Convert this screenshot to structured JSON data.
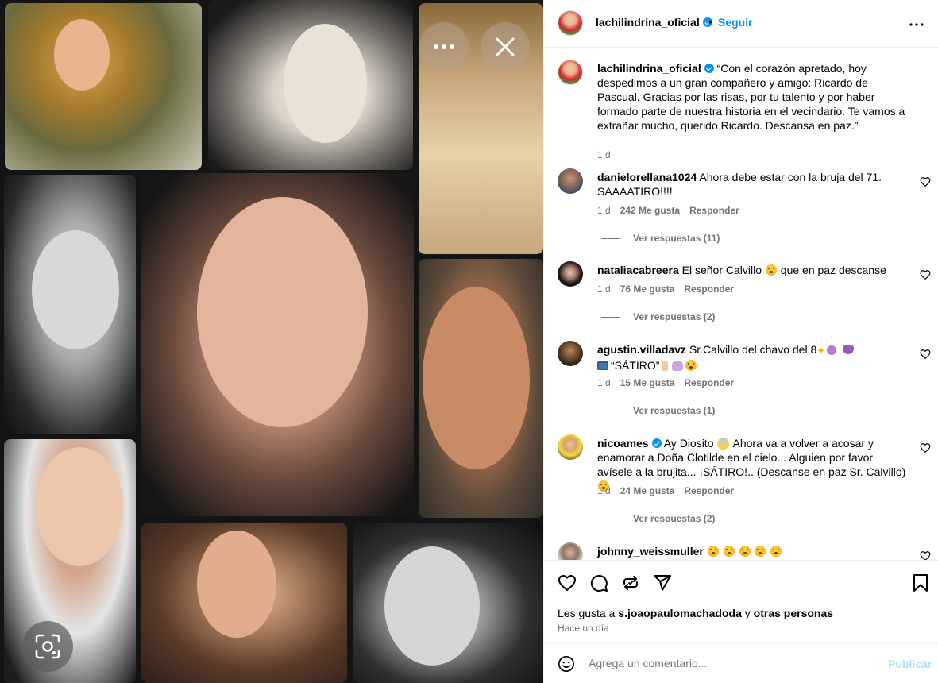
{
  "header": {
    "username": "lachilindrina_oficial",
    "separator": "•",
    "follow_label": "Seguir",
    "more_label": "•••"
  },
  "caption": {
    "username": "lachilindrina_oficial",
    "text": "“Con el corazón apretado, hoy despedimos a un gran compañero y amigo: Ricardo de Pascual. Gracias por las risas, por tu talento y por haber formado parte de nuestra historia en el vecindario. Te vamos a extrañar mucho, querido Ricardo. Descansa en paz.”",
    "time": "1 d"
  },
  "comments": [
    {
      "username": "danielorellana1024",
      "text": "Ahora debe estar con la bruja del 71. SAAAATIRO!!!!",
      "time": "1 d",
      "likes": "242 Me gusta",
      "reply_label": "Responder",
      "view_replies": "Ver respuestas (11)"
    },
    {
      "username": "nataliacabreera",
      "text_before": "El señor Calvillo",
      "text_after": "que en paz descanse",
      "time": "1 d",
      "likes": "76 Me gusta",
      "reply_label": "Responder",
      "view_replies": "Ver respuestas (2)"
    },
    {
      "username": "agustin.villadavz",
      "text_line1": "Sr.Calvillo del chavo del 8",
      "text_line2": "“SÁTIRO”",
      "time": "1 d",
      "likes": "15 Me gusta",
      "reply_label": "Responder",
      "view_replies": "Ver respuestas (1)"
    },
    {
      "username": "nicoames",
      "text_a": "Ay Diosito",
      "text_b": "Ahora va a volver a acosar y enamorar a Doña Clotilde en el cielo... Alguien por favor avísele a la brujita... ¡SÁTIRO!.. (Descanse en paz Sr. Calvillo)",
      "time": "1 d",
      "likes": "24 Me gusta",
      "reply_label": "Responder",
      "view_replies": "Ver respuestas (2)"
    },
    {
      "username": "johnny_weissmuller"
    }
  ],
  "actions": {
    "likes_prefix": "Les gusta a",
    "likes_user": "s.joaopaulomachadoda",
    "likes_mid": "y",
    "likes_others": "otras personas",
    "time": "Hace un día"
  },
  "composer": {
    "placeholder": "Agrega un comentario...",
    "publish_label": "Publicar"
  },
  "colors": {
    "accent": "#0095f6",
    "muted": "#737373",
    "publish_disabled": "#b2dffc"
  },
  "icons": [
    "more-icon",
    "close-icon",
    "lens-icon",
    "heart-icon",
    "comment-icon",
    "share-icon",
    "send-icon",
    "bookmark-icon",
    "emoji-icon",
    "verified-icon"
  ]
}
